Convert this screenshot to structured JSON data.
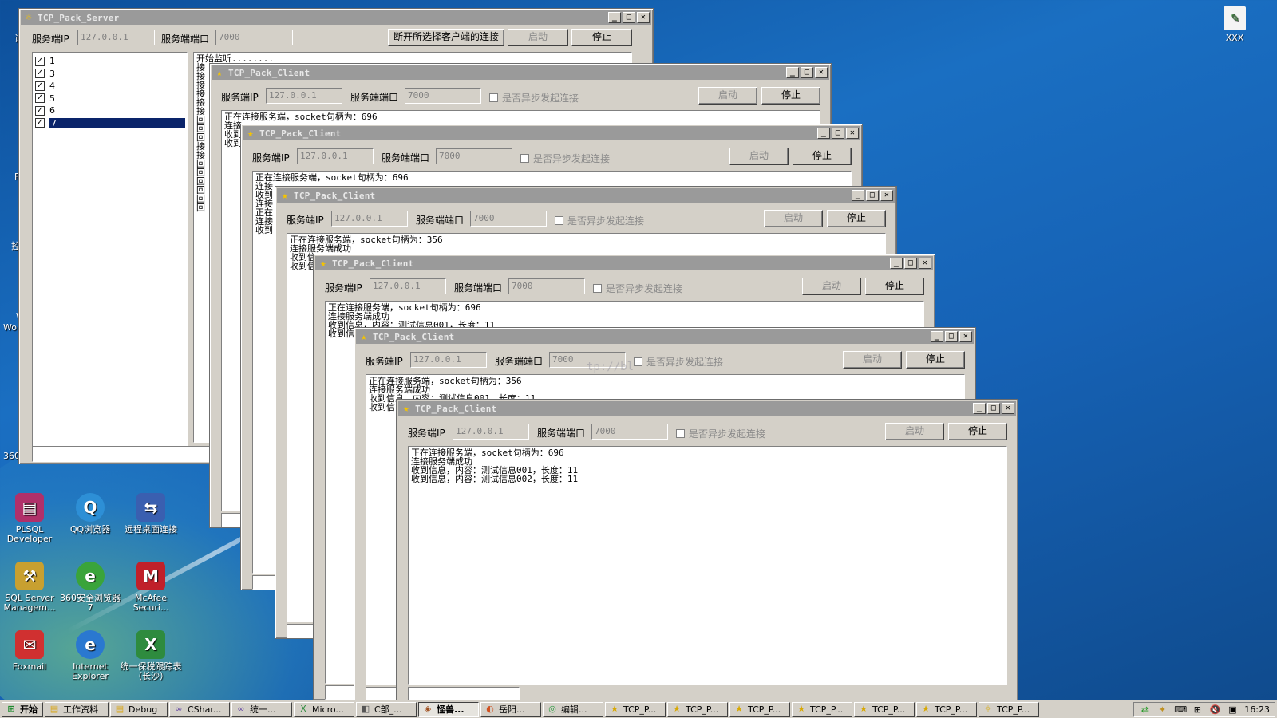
{
  "server": {
    "title": "TCP_Pack_Server",
    "ip_label": "服务端IP",
    "ip_value": "127.0.0.1",
    "port_label": "服务端端口",
    "port_value": "7000",
    "disconnect_label": "断开所选择客户端的连接",
    "start_label": "启动",
    "stop_label": "停止",
    "clients": [
      {
        "label": "1",
        "checked": true,
        "selected": false
      },
      {
        "label": "3",
        "checked": true,
        "selected": false
      },
      {
        "label": "4",
        "checked": true,
        "selected": false
      },
      {
        "label": "5",
        "checked": true,
        "selected": false
      },
      {
        "label": "6",
        "checked": true,
        "selected": false
      },
      {
        "label": "7",
        "checked": true,
        "selected": true
      }
    ],
    "log_first": "开始监听........",
    "log_prefixes": [
      "接",
      "接",
      "接",
      "接",
      "接",
      "接",
      "回",
      "回",
      "回",
      "接",
      "接",
      "回",
      "回",
      "回",
      "回",
      "回",
      "回"
    ]
  },
  "client_common": {
    "title": "TCP_Pack_Client",
    "ip_label": "服务端IP",
    "ip_value": "127.0.0.1",
    "port_label": "服务端端口",
    "port_value": "7000",
    "async_label": "是否异步发起连接",
    "start_label": "启动",
    "stop_label": "停止"
  },
  "clients": [
    {
      "log": [
        "正在连接服务端，socket句柄为：696",
        "连接",
        "收到",
        "收到"
      ]
    },
    {
      "log": [
        "正在连接服务端，socket句柄为：696",
        "连接",
        "收到",
        "连接",
        "正在",
        "连接",
        "收到"
      ]
    },
    {
      "log": [
        "正在连接服务端，socket句柄为：356",
        "连接服务端成功",
        "收到信",
        "收到信"
      ]
    },
    {
      "log": [
        "正在连接服务端，socket句柄为：696",
        "连接服务端成功",
        "收到信息，内容：测试信息001，长度：11",
        "收到信"
      ]
    },
    {
      "log": [
        "正在连接服务端，socket句柄为：356",
        "连接服务端成功",
        "收到信息，内容：测试信息001，长度：11",
        "收到信"
      ]
    },
    {
      "log": [
        "正在连接服务端，socket句柄为：696",
        "连接服务端成功",
        "收到信息，内容：测试信息001，长度：11",
        "收到信息，内容：测试信息002，长度：11"
      ]
    }
  ],
  "desktop_icons": [
    {
      "label": "PLSQL Developer",
      "icon": "database-icon",
      "color": "#b0306a"
    },
    {
      "label": "QQ浏览器",
      "icon": "qq-browser-icon",
      "color": "#2d8fd6"
    },
    {
      "label": "远程桌面连接",
      "icon": "remote-desktop-icon",
      "color": "#3a5fb0"
    },
    {
      "label": "SQL Server Managem...",
      "icon": "sql-server-icon",
      "color": "#c8a030"
    },
    {
      "label": "360安全浏览器7",
      "icon": "browser-360-icon",
      "color": "#3aa43a"
    },
    {
      "label": "McAfee Securi...",
      "icon": "mcafee-icon",
      "color": "#c0202a"
    },
    {
      "label": "Foxmail",
      "icon": "foxmail-icon",
      "color": "#d03030"
    },
    {
      "label": "Internet Explorer",
      "icon": "ie-icon",
      "color": "#2a78d0"
    },
    {
      "label": "统一保税跟踪表（长沙）",
      "icon": "excel-icon",
      "color": "#2e8b3e"
    }
  ],
  "top_right_icon": {
    "label": "XXX",
    "icon": "notepad-icon"
  },
  "edge_texts": [
    "计",
    "F",
    "控",
    "W",
    "Wor",
    "360"
  ],
  "watermark": "tp://bl",
  "taskbar": {
    "start_label": "开始",
    "items": [
      {
        "label": "工作资料",
        "icon": "folder-icon",
        "active": false
      },
      {
        "label": "Debug",
        "icon": "folder-icon",
        "active": false
      },
      {
        "label": "CShar...",
        "icon": "vs-icon",
        "active": false
      },
      {
        "label": "统一...",
        "icon": "vs-icon",
        "active": false
      },
      {
        "label": "Micro...",
        "icon": "excel-icon",
        "active": false
      },
      {
        "label": "C部_...",
        "icon": "app-icon",
        "active": false
      },
      {
        "label": "怪兽...",
        "icon": "game-icon",
        "active": true
      },
      {
        "label": "岳阳...",
        "icon": "browser-icon",
        "active": false
      },
      {
        "label": "编辑...",
        "icon": "chrome-icon",
        "active": false
      },
      {
        "label": "TCP_P...",
        "icon": "star-icon",
        "active": false
      },
      {
        "label": "TCP_P...",
        "icon": "star-icon",
        "active": false
      },
      {
        "label": "TCP_P...",
        "icon": "star-icon",
        "active": false
      },
      {
        "label": "TCP_P...",
        "icon": "star-icon",
        "active": false
      },
      {
        "label": "TCP_P...",
        "icon": "star-icon",
        "active": false
      },
      {
        "label": "TCP_P...",
        "icon": "star-icon",
        "active": false
      },
      {
        "label": "TCP_P...",
        "icon": "sun-icon",
        "active": false
      }
    ],
    "clock": "16:23"
  }
}
